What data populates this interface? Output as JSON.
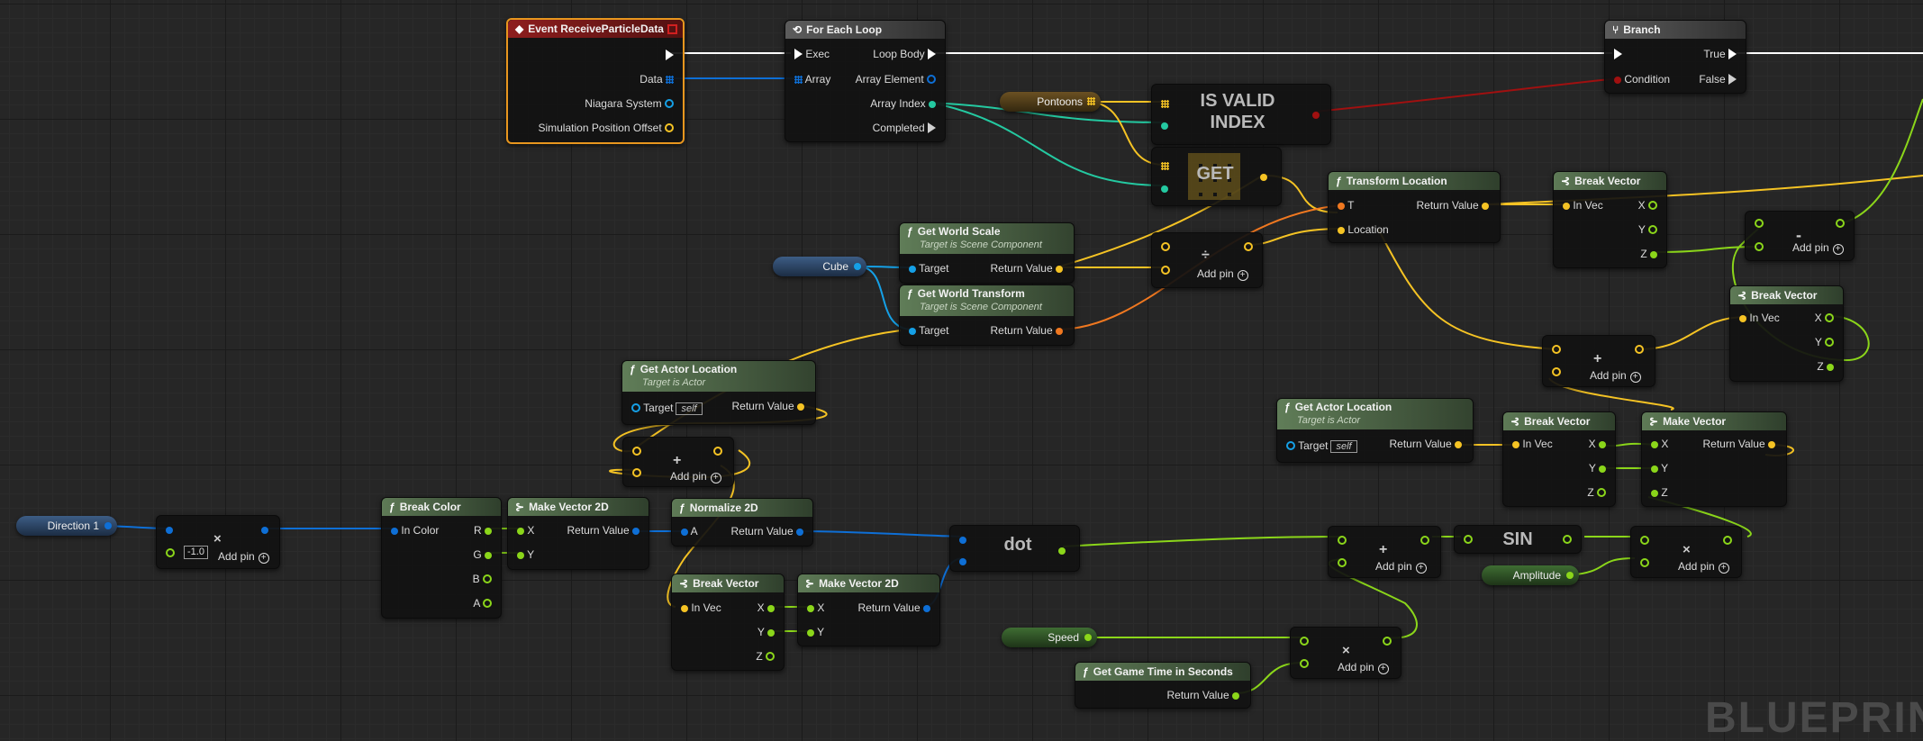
{
  "colors": {
    "exec": "#ffffff",
    "float": "#8bd61a",
    "vector": "#f5c324",
    "struct_blue": "#0e6fd6",
    "object": "#15a0e6",
    "int_teal": "#24c9a1",
    "transform": "#f07820",
    "bool": "#a01010",
    "selection": "#e8961e"
  },
  "nodes": {
    "event": {
      "title": "Event ReceiveParticleData",
      "pins": {
        "data": "Data",
        "niagara_system": "Niagara System",
        "sim_offset": "Simulation Position Offset"
      }
    },
    "foreach": {
      "title": "For Each Loop",
      "pins": {
        "exec": "Exec",
        "array": "Array",
        "loop_body": "Loop Body",
        "array_element": "Array Element",
        "array_index": "Array Index",
        "completed": "Completed"
      }
    },
    "branch": {
      "title": "Branch",
      "pins": {
        "condition": "Condition",
        "true": "True",
        "false": "False"
      }
    },
    "is_valid_index": {
      "label": "IS VALID INDEX"
    },
    "get": {
      "label": "GET"
    },
    "get_world_scale": {
      "title": "Get World Scale",
      "subtitle": "Target is Scene Component",
      "target": "Target",
      "ret": "Return Value"
    },
    "get_world_transform": {
      "title": "Get World Transform",
      "subtitle": "Target is Scene Component",
      "target": "Target",
      "ret": "Return Value"
    },
    "transform_location": {
      "title": "Transform Location",
      "t": "T",
      "location": "Location",
      "ret": "Return Value"
    },
    "break_vector_1": {
      "title": "Break Vector",
      "in_vec": "In Vec",
      "x": "X",
      "y": "Y",
      "z": "Z"
    },
    "break_vector_2": {
      "title": "Break Vector",
      "in_vec": "In Vec",
      "x": "X",
      "y": "Y",
      "z": "Z"
    },
    "break_vector_3": {
      "title": "Break Vector",
      "in_vec": "In Vec",
      "x": "X",
      "y": "Y",
      "z": "Z"
    },
    "break_vector_4": {
      "title": "Break Vector",
      "in_vec": "In Vec",
      "x": "X",
      "y": "Y",
      "z": "Z"
    },
    "get_actor_location_1": {
      "title": "Get Actor Location",
      "subtitle": "Target is Actor",
      "target": "Target",
      "self": "self",
      "ret": "Return Value"
    },
    "get_actor_location_2": {
      "title": "Get Actor Location",
      "subtitle": "Target is Actor",
      "target": "Target",
      "self": "self",
      "ret": "Return Value"
    },
    "make_vector": {
      "title": "Make Vector",
      "x": "X",
      "y": "Y",
      "z": "Z",
      "ret": "Return Value"
    },
    "break_color": {
      "title": "Break Color",
      "in_color": "In Color",
      "r": "R",
      "g": "G",
      "b": "B",
      "a": "A"
    },
    "make_vector_2d_1": {
      "title": "Make Vector 2D",
      "x": "X",
      "y": "Y",
      "ret": "Return Value"
    },
    "make_vector_2d_2": {
      "title": "Make Vector 2D",
      "x": "X",
      "y": "Y",
      "ret": "Return Value"
    },
    "normalize_2d": {
      "title": "Normalize 2D",
      "a": "A",
      "ret": "Return Value"
    },
    "dot": {
      "label": "dot"
    },
    "sin": {
      "label": "SIN"
    },
    "get_game_time": {
      "title": "Get Game Time in Seconds",
      "ret": "Return Value"
    },
    "multiply_neg": {
      "value": "-1.0"
    }
  },
  "variables": {
    "pontoons": "Pontoons",
    "cube": "Cube",
    "direction": "Direction 1",
    "speed": "Speed",
    "amplitude": "Amplitude"
  },
  "operators": {
    "add_pin": "Add pin",
    "plus": "+",
    "minus": "-",
    "times": "×",
    "divide": "÷"
  },
  "watermark": "BLUEPRINT"
}
